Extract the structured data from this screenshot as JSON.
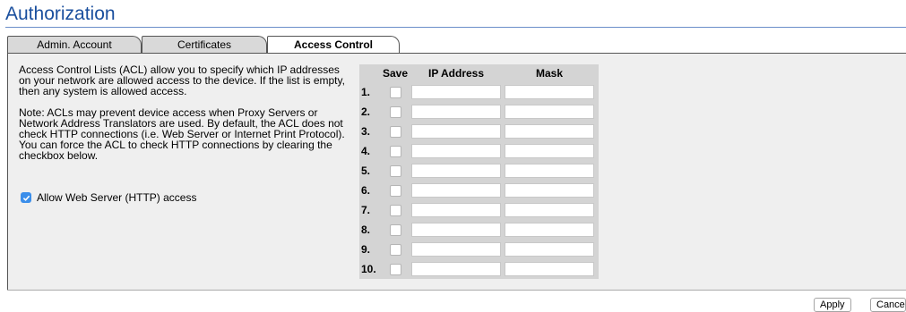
{
  "page": {
    "title": "Authorization"
  },
  "tabs": [
    {
      "label": "Admin. Account",
      "active": false
    },
    {
      "label": "Certificates",
      "active": false
    },
    {
      "label": "Access Control",
      "active": true
    }
  ],
  "description": {
    "para1": "Access Control Lists (ACL) allow you to specify which IP addresses on your network are allowed access to the device. If the list is empty, then any system is allowed access.",
    "para2": "Note: ACLs may prevent device access when Proxy Servers or Network Address Translators are used. By default, the ACL does not check HTTP connections (i.e. Web Server or Internet Print Protocol). You can force the ACL to check HTTP connections by clearing the checkbox below."
  },
  "allow_http": {
    "label": "Allow Web Server (HTTP) access",
    "checked": true
  },
  "acl_table": {
    "headers": {
      "save": "Save",
      "ip": "IP Address",
      "mask": "Mask"
    },
    "rows": [
      {
        "num": "1.",
        "ip": "",
        "mask": ""
      },
      {
        "num": "2.",
        "ip": "",
        "mask": ""
      },
      {
        "num": "3.",
        "ip": "",
        "mask": ""
      },
      {
        "num": "4.",
        "ip": "",
        "mask": ""
      },
      {
        "num": "5.",
        "ip": "",
        "mask": ""
      },
      {
        "num": "6.",
        "ip": "",
        "mask": ""
      },
      {
        "num": "7.",
        "ip": "",
        "mask": ""
      },
      {
        "num": "8.",
        "ip": "",
        "mask": ""
      },
      {
        "num": "9.",
        "ip": "",
        "mask": ""
      },
      {
        "num": "10.",
        "ip": "",
        "mask": ""
      }
    ]
  },
  "buttons": {
    "apply": "Apply",
    "cancel": "Cance"
  },
  "colors": {
    "title": "#1a4f9e",
    "checkbox_checked": "#3b8eea",
    "panel_bg": "#efefef",
    "table_bg": "#d4d4d4"
  }
}
